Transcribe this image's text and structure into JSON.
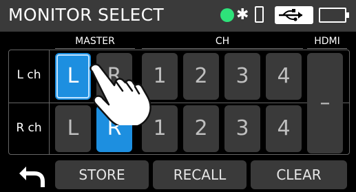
{
  "header": {
    "title": "MONITOR SELECT",
    "icons": [
      "status-led",
      "bluetooth-icon",
      "sd-card-icon",
      "usb-icon",
      "battery-icon"
    ]
  },
  "column_headers": {
    "master": "MASTER",
    "ch": "CH",
    "hdmi": "HDMI"
  },
  "rows": [
    {
      "label": "L ch",
      "master": [
        {
          "label": "L",
          "active": true
        },
        {
          "label": "R",
          "active": false
        }
      ],
      "ch": [
        "1",
        "2",
        "3",
        "4"
      ]
    },
    {
      "label": "R ch",
      "master": [
        {
          "label": "L",
          "active": false
        },
        {
          "label": "R",
          "active": true
        }
      ],
      "ch": [
        "1",
        "2",
        "3",
        "4"
      ]
    }
  ],
  "hdmi": {
    "value": "–"
  },
  "bottom": {
    "store": "STORE",
    "recall": "RECALL",
    "clear": "CLEAR",
    "back": "back-arrow-icon"
  },
  "colors": {
    "active": "#1d8fe0",
    "button": "#3a3a3a",
    "status_led": "#2ee27a"
  }
}
